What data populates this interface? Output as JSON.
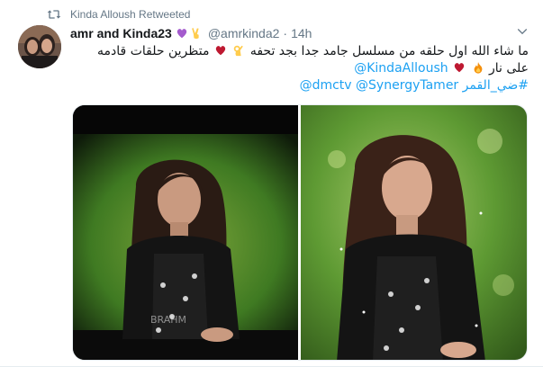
{
  "retweet": {
    "icon": "retweet-icon",
    "text": "Kinda Alloush Retweeted"
  },
  "author": {
    "display_name": "amr and Kinda23",
    "handle": "@amrkinda2",
    "separator": "·",
    "time": "14h",
    "emojis": [
      "purple-heart-icon",
      "victory-hand-icon"
    ]
  },
  "tweet": {
    "line1": "ما شاء الله اول حلقه من مسلسل جامد جدا بجد تحفه",
    "line1_end": "متظرين حلقات قادمه",
    "line2_start": "على نار",
    "line2_mention": "@KindaAlloush",
    "line3_hashtag": "#ضي_القمر",
    "line3_mention1": "@SynergyTamer",
    "line3_mention2": "@dmctv",
    "emojis": [
      "ok-hand-icon",
      "red-heart-icon",
      "fire-icon",
      "red-heart-icon"
    ]
  },
  "media": {
    "photos": [
      "photo-left",
      "photo-right"
    ],
    "overlay_text": "BRAHM"
  },
  "colors": {
    "link": "#1da1f2",
    "secondary": "#657786",
    "primary": "#14171a",
    "retweet_green": "#17bf63"
  }
}
